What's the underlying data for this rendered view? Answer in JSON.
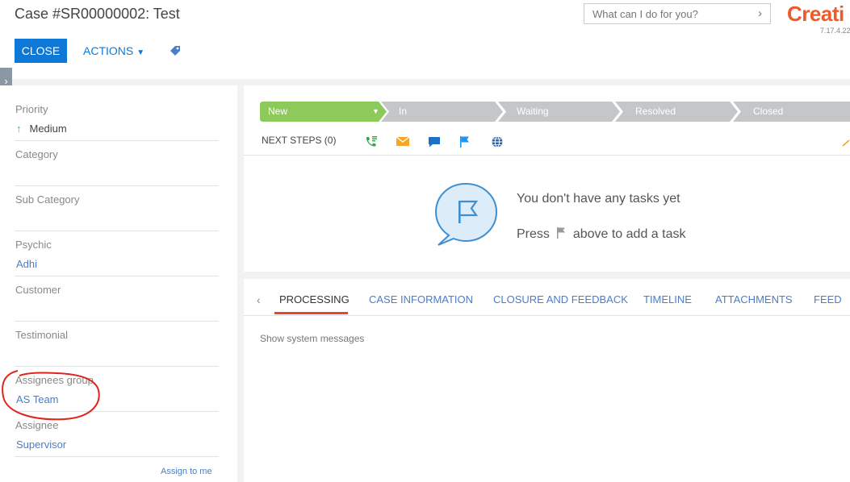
{
  "header": {
    "title": "Case #SR00000002: Test",
    "search_placeholder": "What can I do for you?",
    "logo": "Creati",
    "version": "7.17.4.22"
  },
  "toolbar": {
    "close_label": "CLOSE",
    "actions_label": "ACTIONS"
  },
  "fields": {
    "priority": {
      "label": "Priority",
      "value": "Medium"
    },
    "category": {
      "label": "Category",
      "value": ""
    },
    "sub_category": {
      "label": "Sub Category",
      "value": ""
    },
    "psychic": {
      "label": "Psychic",
      "value": "Adhi"
    },
    "customer": {
      "label": "Customer",
      "value": ""
    },
    "testimonial": {
      "label": "Testimonial",
      "value": ""
    },
    "assignees_group": {
      "label": "Assignees group",
      "value": "AS Team"
    },
    "assignee": {
      "label": "Assignee",
      "value": "Supervisor"
    },
    "assign_to_me": "Assign to me"
  },
  "stages": [
    "New",
    "In progress",
    "Waiting for response",
    "Resolved",
    "Closed"
  ],
  "next_steps": {
    "label": "NEXT STEPS (0)",
    "empty_title": "You don't have any tasks yet",
    "empty_sub_before": "Press",
    "empty_sub_after": "above to add a task"
  },
  "tabs": [
    "PROCESSING",
    "CASE INFORMATION",
    "CLOSURE AND FEEDBACK",
    "TIMELINE",
    "ATTACHMENTS",
    "FEED"
  ],
  "processing": {
    "system_messages": "Show system messages"
  },
  "colors": {
    "primary": "#0d78d6",
    "stage_active": "#8ec95b",
    "stage_inactive": "#c4c6c8",
    "tab_active_underline": "#e8472c",
    "logo": "#f05a28",
    "link": "#4b7dc9"
  }
}
